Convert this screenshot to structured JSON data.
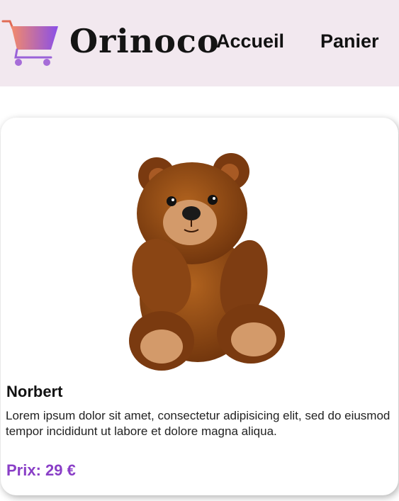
{
  "header": {
    "brand": "Orinoco",
    "nav": {
      "home_label": "Accueil",
      "cart_label": "Panier"
    }
  },
  "product": {
    "name": "Norbert",
    "description": "Lorem ipsum dolor sit amet, consectetur adipisicing elit, sed do eiusmod tempor incididunt ut labore et dolore magna aliqua.",
    "price": "Prix: 29 €",
    "image_subject": "brown teddy bear"
  },
  "colors": {
    "header_bg": "#f2e8ef",
    "cart_gradient_start": "#f28a6b",
    "cart_gradient_end": "#8a4fe8",
    "price": "#8a3fc7"
  }
}
